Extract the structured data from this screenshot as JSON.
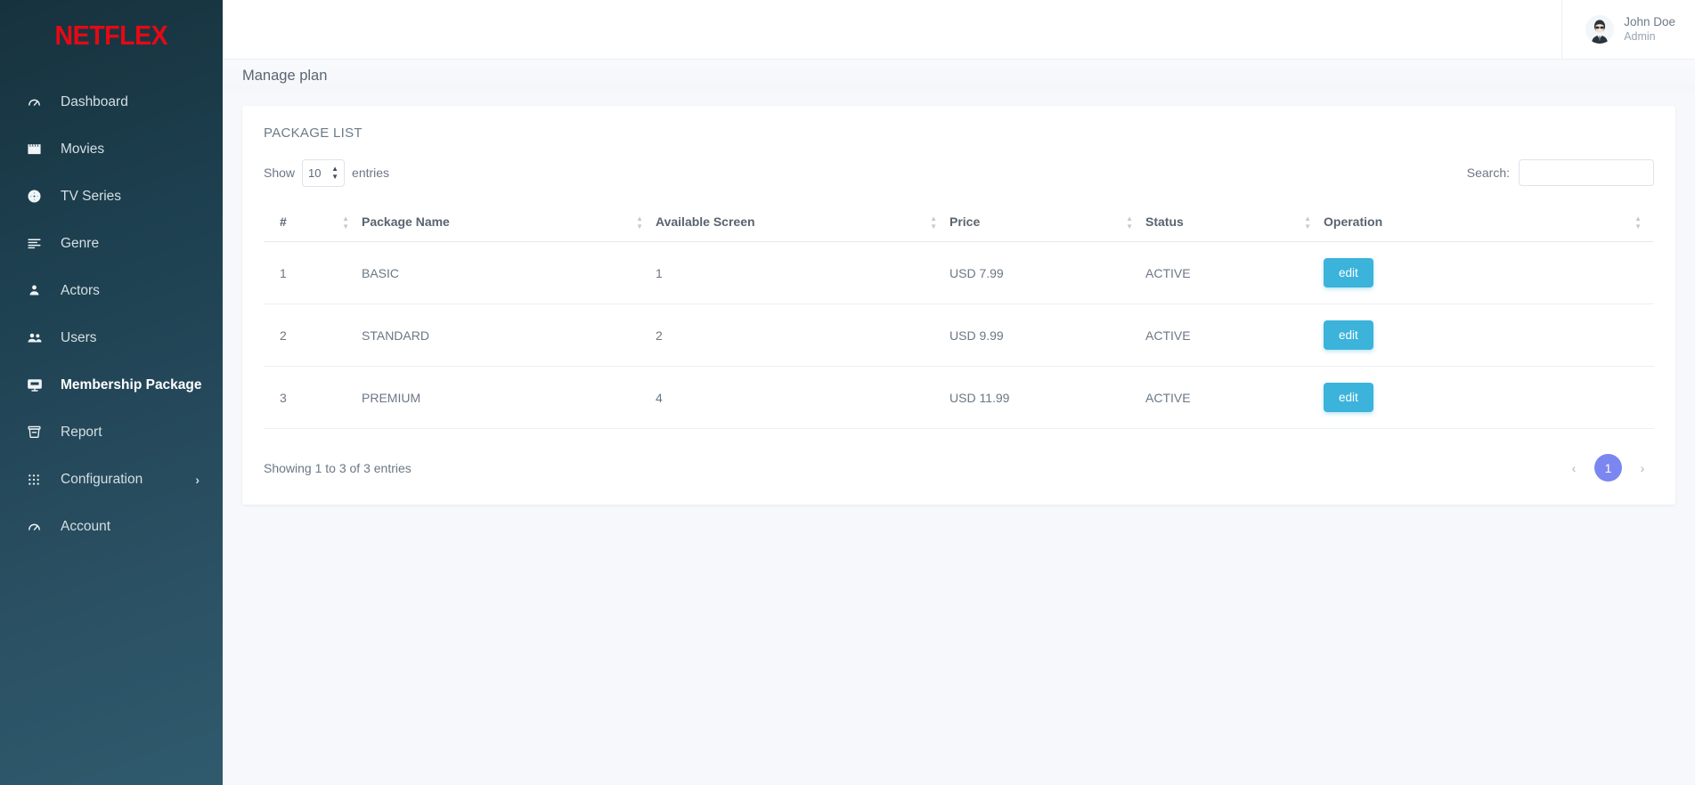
{
  "sidebar": {
    "logo": "NETFLEX",
    "items": [
      {
        "label": "Dashboard",
        "icon": "speedometer-icon",
        "active": false,
        "has_chevron": false
      },
      {
        "label": "Movies",
        "icon": "clapperboard-icon",
        "active": false,
        "has_chevron": false
      },
      {
        "label": "TV Series",
        "icon": "film-reel-icon",
        "active": false,
        "has_chevron": false
      },
      {
        "label": "Genre",
        "icon": "list-lines-icon",
        "active": false,
        "has_chevron": false
      },
      {
        "label": "Actors",
        "icon": "person-icon",
        "active": false,
        "has_chevron": false
      },
      {
        "label": "Users",
        "icon": "people-icon",
        "active": false,
        "has_chevron": false
      },
      {
        "label": "Membership Package",
        "icon": "monitor-icon",
        "active": true,
        "has_chevron": false
      },
      {
        "label": "Report",
        "icon": "archive-box-icon",
        "active": false,
        "has_chevron": false
      },
      {
        "label": "Configuration",
        "icon": "grid-dots-icon",
        "active": false,
        "has_chevron": true
      },
      {
        "label": "Account",
        "icon": "speedometer-icon",
        "active": false,
        "has_chevron": false
      }
    ]
  },
  "topbar": {
    "profile_name": "John Doe",
    "profile_role": "Admin"
  },
  "page": {
    "title": "Manage plan"
  },
  "card": {
    "title": "PACKAGE LIST"
  },
  "controls": {
    "show_label": "Show",
    "entries_label": "entries",
    "page_length": "10",
    "search_label": "Search:",
    "search_value": "",
    "search_placeholder": ""
  },
  "table": {
    "columns": [
      {
        "label": "#",
        "sortable": true
      },
      {
        "label": "Package Name",
        "sortable": true
      },
      {
        "label": "Available Screen",
        "sortable": true
      },
      {
        "label": "Price",
        "sortable": true
      },
      {
        "label": "Status",
        "sortable": true
      },
      {
        "label": "Operation",
        "sortable": true
      }
    ],
    "rows": [
      {
        "num": "1",
        "name": "BASIC",
        "screens": "1",
        "price": "USD 7.99",
        "status": "ACTIVE",
        "action": "edit"
      },
      {
        "num": "2",
        "name": "STANDARD",
        "screens": "2",
        "price": "USD 9.99",
        "status": "ACTIVE",
        "action": "edit"
      },
      {
        "num": "3",
        "name": "PREMIUM",
        "screens": "4",
        "price": "USD 11.99",
        "status": "ACTIVE",
        "action": "edit"
      }
    ]
  },
  "footer": {
    "showing": "Showing 1 to 3 of 3 entries",
    "prev": "‹",
    "next": "›",
    "current_page": "1"
  },
  "colors": {
    "brand_red": "#e50914",
    "sidebar_top": "#16323d",
    "sidebar_bottom": "#2f5a6d",
    "edit_button": "#3bb3db",
    "pagination_active": "#7c86f0",
    "page_background": "#f7f8fc"
  }
}
